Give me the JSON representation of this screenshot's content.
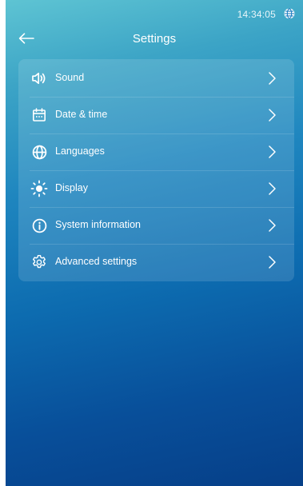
{
  "status_bar": {
    "time": "14:34:05",
    "language_icon": "globe-icon"
  },
  "header": {
    "back_icon": "arrow-left-icon",
    "title": "Settings"
  },
  "menu": {
    "items": [
      {
        "id": "sound",
        "label": "Sound",
        "icon": "speaker-icon"
      },
      {
        "id": "date-time",
        "label": "Date & time",
        "icon": "calendar-icon"
      },
      {
        "id": "languages",
        "label": "Languages",
        "icon": "globe-icon"
      },
      {
        "id": "display",
        "label": "Display",
        "icon": "sun-icon"
      },
      {
        "id": "system-information",
        "label": "System information",
        "icon": "info-icon"
      },
      {
        "id": "advanced-settings",
        "label": "Advanced settings",
        "icon": "gear-icon"
      }
    ],
    "chevron_icon": "chevron-right-icon"
  },
  "colors": {
    "background_top": "#5ec4d3",
    "background_bottom": "#063f88",
    "text": "#ffffff"
  }
}
